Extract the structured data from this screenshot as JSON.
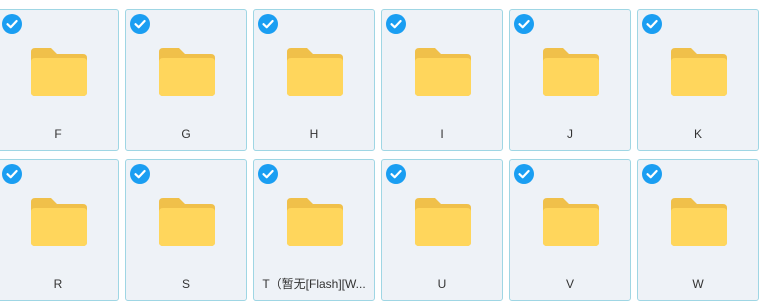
{
  "colors": {
    "check_blue": "#1a9ef2",
    "folder_back": "#f0c04a",
    "folder_front": "#ffd65c",
    "tile_bg": "#eef2f7",
    "tile_border": "#9fd6e4"
  },
  "icons": {
    "selected": "check-circle-icon",
    "item": "folder-icon"
  },
  "rows": [
    [
      {
        "label": "F",
        "selected": true
      },
      {
        "label": "G",
        "selected": true
      },
      {
        "label": "H",
        "selected": true
      },
      {
        "label": "I",
        "selected": true
      },
      {
        "label": "J",
        "selected": true
      },
      {
        "label": "K",
        "selected": true
      }
    ],
    [
      {
        "label": "R",
        "selected": true
      },
      {
        "label": "S",
        "selected": true
      },
      {
        "label": "T（暂无[Flash][W...",
        "selected": true
      },
      {
        "label": "U",
        "selected": true
      },
      {
        "label": "V",
        "selected": true
      },
      {
        "label": "W",
        "selected": true
      }
    ]
  ]
}
